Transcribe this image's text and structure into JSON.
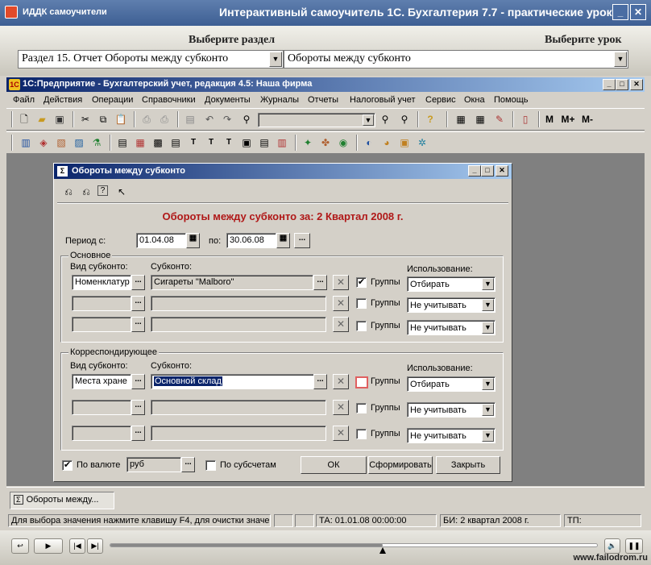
{
  "outer": {
    "app_name": "ИДДК самоучители",
    "title": "Интерактивный самоучитель 1С. Бухгалтерия 7.7 - практические уроки",
    "select_section_label": "Выберите раздел",
    "select_lesson_label": "Выберите урок",
    "section_value": "Раздел 15. Отчет Обороты между субконто",
    "lesson_value": "Обороты между субконто"
  },
  "app": {
    "title": "1С:Предприятие - Бухгалтерский учет, редакция 4.5: Наша фирма",
    "menu": [
      "Файл",
      "Действия",
      "Операции",
      "Справочники",
      "Документы",
      "Журналы",
      "Отчеты",
      "Налоговый учет",
      "Сервис",
      "Окна",
      "Помощь"
    ],
    "toolbar_text_buttons": [
      "M",
      "M+",
      "M-"
    ]
  },
  "dialog": {
    "title": "Обороты между субконто",
    "heading": "Обороты между субконто за: 2 Квартал 2008 г.",
    "period_label": "Период с:",
    "period_from": "01.04.08",
    "period_to_label": "по:",
    "period_to": "30.06.08",
    "main_group": {
      "title": "Основное",
      "col_type": "Вид субконто:",
      "col_subconto": "Субконто:",
      "col_usage": "Использование:",
      "rows": [
        {
          "type": "Номенклатур",
          "subconto": "Сигареты \"Malboro\"",
          "groups_label": "Группы",
          "groups_checked": true,
          "usage": "Отбирать"
        },
        {
          "type": "",
          "subconto": "",
          "groups_label": "Группы",
          "groups_checked": false,
          "usage": "Не учитывать"
        },
        {
          "type": "",
          "subconto": "",
          "groups_label": "Группы",
          "groups_checked": false,
          "usage": "Не учитывать"
        }
      ]
    },
    "corr_group": {
      "title": "Корреспондирующее",
      "col_type": "Вид субконто:",
      "col_subconto": "Субконто:",
      "col_usage": "Использование:",
      "rows": [
        {
          "type": "Места хране",
          "subconto": "Основной склад",
          "groups_label": "Группы",
          "groups_checked": false,
          "usage": "Отбирать"
        },
        {
          "type": "",
          "subconto": "",
          "groups_label": "Группы",
          "groups_checked": false,
          "usage": "Не учитывать"
        },
        {
          "type": "",
          "subconto": "",
          "groups_label": "Группы",
          "groups_checked": false,
          "usage": "Не учитывать"
        }
      ]
    },
    "by_currency_label": "По валюте",
    "by_currency_checked": true,
    "currency_value": "руб",
    "by_subaccounts_label": "По субсчетам",
    "ok_label": "ОК",
    "form_label": "Сформировать",
    "close_label": "Закрыть"
  },
  "taskbar": {
    "item": "Обороты между..."
  },
  "status": {
    "hint": "Для выбора значения нажмите клавишу F4, для очистки значе",
    "ta": "ТА: 01.01.08  00:00:00",
    "bi": "БИ: 2 квартал 2008 г.",
    "tp": "ТП:"
  },
  "player": {
    "progress": 0.56,
    "watermark": "www.failodrom.ru"
  },
  "colors": {
    "heading_red": "#b01818",
    "title_blue": "#0a246a"
  }
}
